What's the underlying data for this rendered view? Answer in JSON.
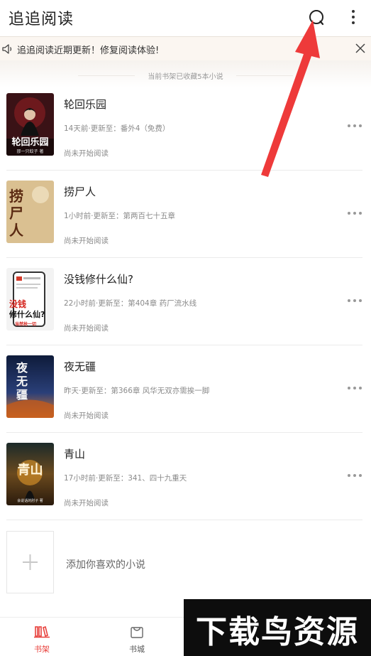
{
  "header": {
    "title": "追追阅读"
  },
  "notice": {
    "text": "追追阅读近期更新！修复阅读体验!"
  },
  "shelf": {
    "summary": "当前书架已收藏5本小说"
  },
  "books": [
    {
      "title": "轮回乐园",
      "update": "14天前·更新至：番外4（免费）",
      "status": "尚未开始阅读",
      "cover_text": "轮回乐园",
      "cover_author": "那一只蚊子 著"
    },
    {
      "title": "捞尸人",
      "update": "1小时前·更新至：第两百七十五章",
      "status": "尚未开始阅读",
      "cover_text": "捞尸人"
    },
    {
      "title": "没钱修什么仙?",
      "update": "22小时前·更新至：第404章 药厂流水线",
      "status": "尚未开始阅读",
      "cover_text_top": "没钱",
      "cover_text_mid": "修什么仙?",
      "cover_text_bottom": "当然抢一切"
    },
    {
      "title": "夜无疆",
      "update": "昨天·更新至：第366章 风华无双亦需挨一脚",
      "status": "尚未开始阅读",
      "cover_text": "夜无疆"
    },
    {
      "title": "青山",
      "update": "17小时前·更新至：341、四十九重天",
      "status": "尚未开始阅读",
      "cover_text": "青山",
      "cover_author": "会说话的肘子 著"
    }
  ],
  "add_book": {
    "label": "添加你喜欢的小说"
  },
  "tabs": [
    {
      "label": "书架",
      "icon": "bookshelf-icon",
      "active": true
    },
    {
      "label": "书城",
      "icon": "store-icon",
      "active": false
    }
  ],
  "watermark": {
    "text": "下载鸟资源"
  },
  "colors": {
    "accent": "#e8413c",
    "arrow": "#ee3a3a",
    "notice_bg": "#fbf6f1"
  }
}
